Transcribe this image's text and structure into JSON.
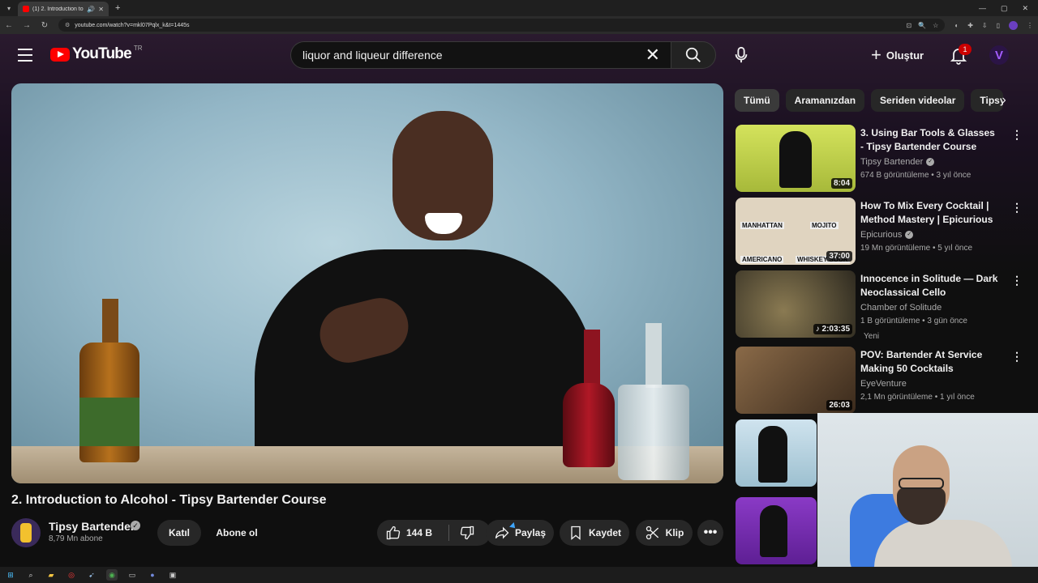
{
  "browser": {
    "tab_title": "(1) 2. Introduction to Alcoh",
    "url": "youtube.com/watch?v=mkl07Pqlx_k&t=1445s"
  },
  "masthead": {
    "logo_text": "YouTube",
    "logo_country": "TR",
    "search_value": "liquor and liqueur difference",
    "create_label": "Oluştur",
    "notification_count": "1",
    "account_initial": "V"
  },
  "video": {
    "title": "2. Introduction to Alcohol - Tipsy Bartender Course",
    "channel_name": "Tipsy Bartender",
    "subscribers": "8,79 Mn abone",
    "join_label": "Katıl",
    "subscribe_label": "Abone ol",
    "like_count": "144 B",
    "share_label": "Paylaş",
    "save_label": "Kaydet",
    "clip_label": "Klip"
  },
  "chips": [
    "Tümü",
    "Aramanızdan",
    "Seriden videolar",
    "Tipsy"
  ],
  "recommendations": [
    {
      "title": "3. Using Bar Tools & Glasses - Tipsy Bartender Course",
      "channel": "Tipsy Bartender",
      "verified": true,
      "meta": "674 B görüntüleme • 3 yıl önce",
      "duration": "8:04",
      "thumb_color": "#c9d94a"
    },
    {
      "title": "How To Mix Every Cocktail | Method Mastery | Epicurious",
      "channel": "Epicurious",
      "verified": true,
      "meta": "19 Mn görüntüleme • 5 yıl önce",
      "duration": "37:00",
      "thumb_color": "#d8c7b0"
    },
    {
      "title": "Innocence in Solitude — Dark Neoclassical Cello",
      "channel": "Chamber of Solitude",
      "verified": false,
      "meta": "1 B görüntüleme • 3 gün önce",
      "duration": "2:03:35",
      "badge": "Yeni",
      "thumb_color": "#4a4434"
    },
    {
      "title": "POV: Bartender At Service Making 50 Cocktails",
      "channel": "EyeVenture",
      "verified": false,
      "meta": "2,1 Mn görüntüleme • 1 yıl önce",
      "duration": "26:03",
      "thumb_color": "#5a4632"
    }
  ],
  "rec_thumb_labels": [
    "MANHATTAN",
    "MOJITO",
    "AMERICANO",
    "WHISKEY SOUR"
  ]
}
